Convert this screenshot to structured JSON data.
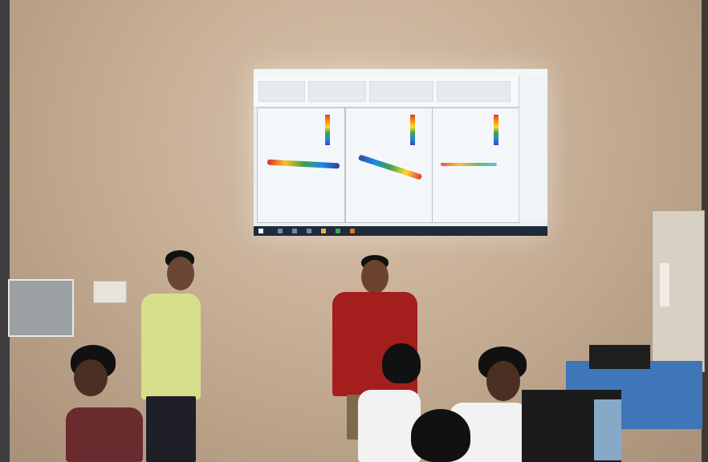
{
  "scene": {
    "description_type": "photo",
    "colors": {
      "wall": "#c6ae95",
      "screen": "#e9f0f3",
      "yellow_shirt": "#d7df8a",
      "red_shirt": "#a51e1e",
      "white_shirt": "#f2f2f2",
      "monitor_blue": "#3f76b8"
    },
    "icons": [
      "projector-screen",
      "wall-board",
      "switch-panel",
      "cabinet"
    ]
  }
}
